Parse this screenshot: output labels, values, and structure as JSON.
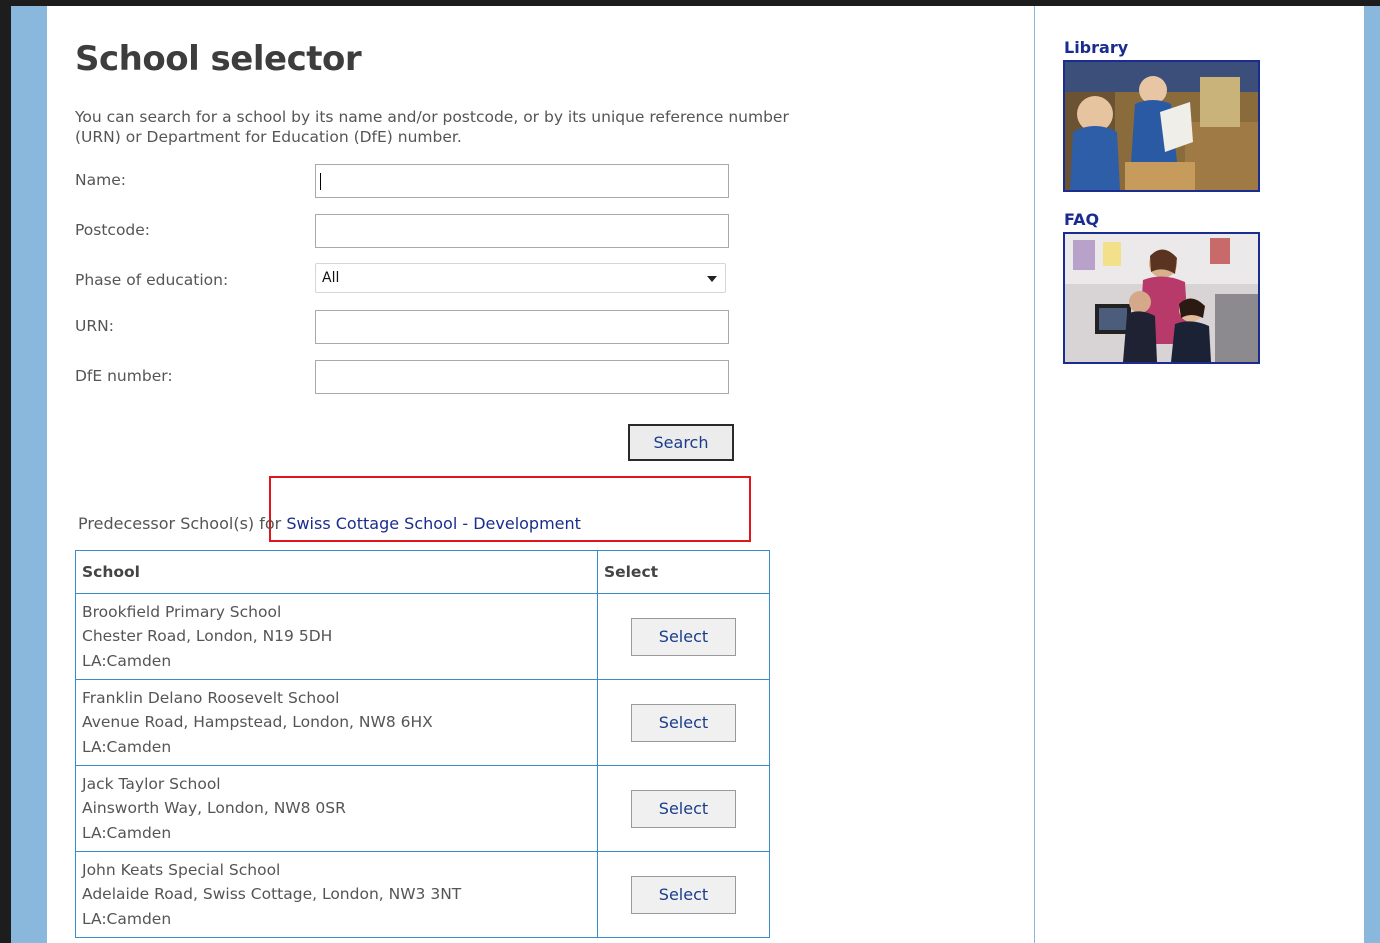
{
  "page": {
    "title": "School selector",
    "intro": "You can search for a school by its name and/or postcode, or by its unique reference number (URN) or Department for Education (DfE) number."
  },
  "form": {
    "name_label": "Name:",
    "name_value": "",
    "postcode_label": "Postcode:",
    "postcode_value": "",
    "phase_label": "Phase of education:",
    "phase_selected": "All",
    "urn_label": "URN:",
    "urn_value": "",
    "dfe_label": "DfE number:",
    "dfe_value": "",
    "search_button": "Search"
  },
  "predecessor": {
    "prefix": "Predecessor School(s) for ",
    "school_link": "Swiss Cottage School - Development"
  },
  "table": {
    "headers": [
      "School",
      "Select"
    ],
    "select_label": "Select",
    "rows": [
      {
        "name": "Brookfield Primary School",
        "address": "Chester Road, London, N19 5DH",
        "la": "LA:Camden"
      },
      {
        "name": "Franklin Delano Roosevelt School",
        "address": "Avenue Road, Hampstead, London, NW8 6HX",
        "la": "LA:Camden"
      },
      {
        "name": "Jack Taylor School",
        "address": "Ainsworth Way, London, NW8 0SR",
        "la": "LA:Camden"
      },
      {
        "name": "John Keats Special School",
        "address": "Adelaide Road, Swiss Cottage, London, NW3 3NT",
        "la": "LA:Camden"
      }
    ]
  },
  "sidebar": {
    "library_label": "Library",
    "faq_label": "FAQ"
  },
  "colors": {
    "frame_blue": "#8ab8dd",
    "link_blue": "#1a2d8f",
    "table_border": "#3a8cc9",
    "highlight_red": "#e0161b"
  }
}
